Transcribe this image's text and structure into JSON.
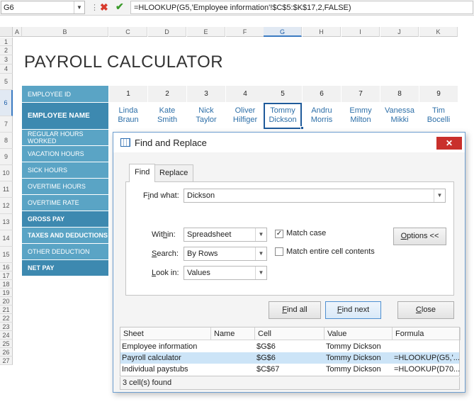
{
  "formula_bar": {
    "name_box": "G6",
    "formula": "=HLOOKUP(G5,'Employee information'!$C$5:$K$17,2,FALSE)",
    "cancel_icon": "cross-icon",
    "confirm_icon": "check-icon"
  },
  "columns": [
    "A",
    "B",
    "C",
    "D",
    "E",
    "F",
    "G",
    "H",
    "I",
    "J",
    "K"
  ],
  "rows": [
    "1",
    "2",
    "3",
    "4",
    "5",
    "6",
    "7",
    "8",
    "9",
    "10",
    "11",
    "12",
    "13",
    "14",
    "15",
    "16",
    "17",
    "18",
    "19",
    "20",
    "21",
    "22",
    "23",
    "24",
    "25",
    "26",
    "27"
  ],
  "sheet": {
    "title": "PAYROLL CALCULATOR",
    "labels": {
      "employee_id": "EMPLOYEE ID",
      "employee_name": "EMPLOYEE NAME",
      "regular_hours": "REGULAR HOURS WORKED",
      "vacation_hours": "VACATION HOURS",
      "sick_hours": "SICK HOURS",
      "overtime_hours": "OVERTIME HOURS",
      "overtime_rate": "OVERTIME RATE",
      "gross_pay": "GROSS PAY",
      "taxes": "TAXES AND DEDUCTIONS",
      "other_deduction": "OTHER DEDUCTION",
      "net_pay": "NET PAY"
    },
    "employees": [
      {
        "id": "1",
        "first": "Linda",
        "last": "Braun"
      },
      {
        "id": "2",
        "first": "Kate",
        "last": "Smith"
      },
      {
        "id": "3",
        "first": "Nick",
        "last": "Taylor"
      },
      {
        "id": "4",
        "first": "Oliver",
        "last": "Hilfiger"
      },
      {
        "id": "5",
        "first": "Tommy",
        "last": "Dickson"
      },
      {
        "id": "6",
        "first": "Andru",
        "last": "Morris"
      },
      {
        "id": "7",
        "first": "Emmy",
        "last": "Milton"
      },
      {
        "id": "8",
        "first": "Vanessa",
        "last": "Mikki"
      },
      {
        "id": "9",
        "first": "Tim",
        "last": "Bocelli"
      }
    ]
  },
  "dialog": {
    "title": "Find and Replace",
    "close_icon": "close-icon",
    "tabs": {
      "find": "Find",
      "replace": "Replace"
    },
    "find_what_label": "Find what:",
    "find_what_value": "Dickson",
    "within_label": "Within:",
    "within_value": "Spreadsheet",
    "search_label": "Search:",
    "search_value": "By Rows",
    "lookin_label": "Look in:",
    "lookin_value": "Values",
    "match_case_label": "Match case",
    "match_case_checked": true,
    "match_entire_label": "Match entire cell contents",
    "match_entire_checked": false,
    "options_button": "Options <<",
    "find_all_button": "Find all",
    "find_next_button": "Find next",
    "close_button": "Close",
    "results": {
      "headers": [
        "Sheet",
        "Name",
        "Cell",
        "Value",
        "Formula"
      ],
      "rows": [
        {
          "sheet": "Employee information",
          "name": "",
          "cell": "$G$6",
          "value": "Tommy Dickson",
          "formula": ""
        },
        {
          "sheet": "Payroll calculator",
          "name": "",
          "cell": "$G$6",
          "value": "Tommy Dickson",
          "formula": "=HLOOKUP(G5,'..."
        },
        {
          "sheet": "Individual paystubs",
          "name": "",
          "cell": "$C$67",
          "value": "Tommy Dickson",
          "formula": "=HLOOKUP(D70..."
        }
      ]
    },
    "status": "3 cell(s) found"
  }
}
